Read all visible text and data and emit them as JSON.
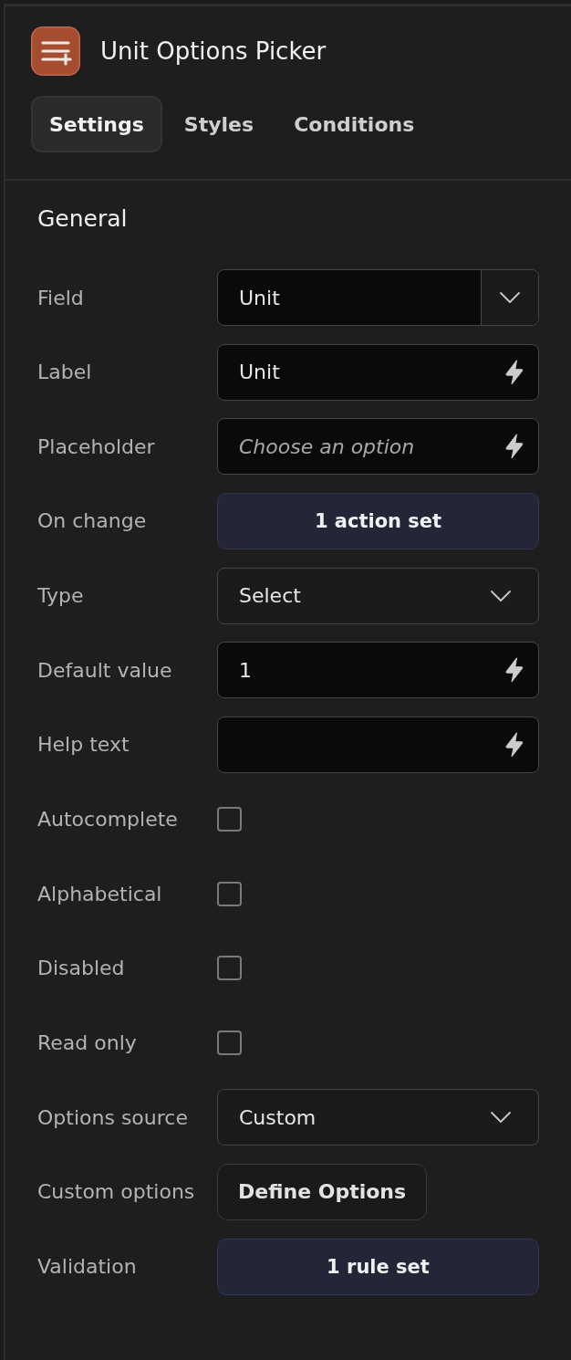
{
  "header": {
    "title": "Unit Options Picker"
  },
  "tabs": [
    {
      "label": "Settings",
      "selected": true
    },
    {
      "label": "Styles",
      "selected": false
    },
    {
      "label": "Conditions",
      "selected": false
    }
  ],
  "section": {
    "title": "General"
  },
  "rows": [
    {
      "label": "Field",
      "kind": "combo",
      "value": "Unit"
    },
    {
      "label": "Label",
      "kind": "dynamic_input",
      "value": "Unit"
    },
    {
      "label": "Placeholder",
      "kind": "dynamic_input",
      "placeholder": "Choose an option"
    },
    {
      "label": "On change",
      "kind": "action",
      "text": "1 action set"
    },
    {
      "label": "Type",
      "kind": "select",
      "value": "Select"
    },
    {
      "label": "Default value",
      "kind": "dynamic_input",
      "value": "1"
    },
    {
      "label": "Help text",
      "kind": "dynamic_input"
    },
    {
      "label": "Autocomplete",
      "kind": "checkbox",
      "checked": false
    },
    {
      "label": "Alphabetical",
      "kind": "checkbox",
      "checked": false
    },
    {
      "label": "Disabled",
      "kind": "checkbox",
      "checked": false
    },
    {
      "label": "Read only",
      "kind": "checkbox",
      "checked": false
    },
    {
      "label": "Options source",
      "kind": "select",
      "value": "Custom"
    },
    {
      "label": "Custom options",
      "kind": "button",
      "text": "Define Options"
    },
    {
      "label": "Validation",
      "kind": "action",
      "text": "1 rule set"
    }
  ]
}
